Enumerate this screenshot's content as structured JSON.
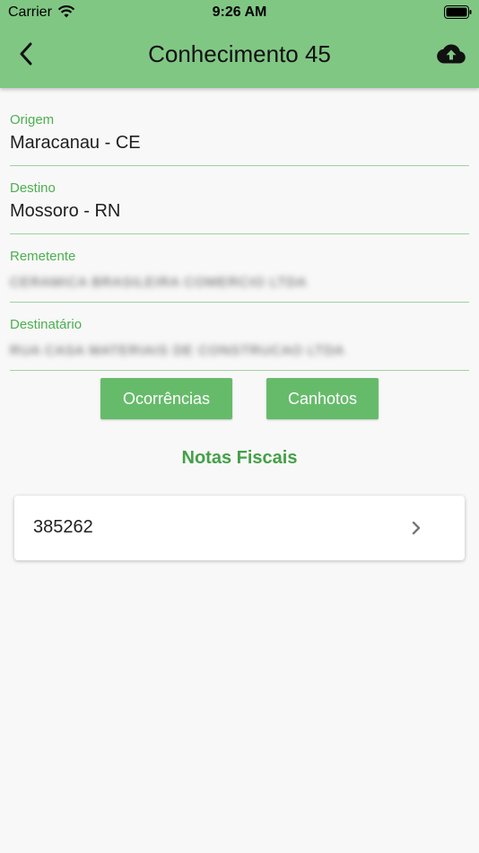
{
  "status_bar": {
    "carrier": "Carrier",
    "time": "9:26 AM"
  },
  "app_bar": {
    "title": "Conhecimento 45",
    "back_icon": "chevron-left-icon",
    "upload_icon": "cloud-upload-icon",
    "color": "#81c784"
  },
  "fields": {
    "origem": {
      "label": "Origem",
      "value": "Maracanau - CE"
    },
    "destino": {
      "label": "Destino",
      "value": "Mossoro - RN"
    },
    "remetente": {
      "label": "Remetente",
      "value": "CERAMICA BRASILEIRA COMERCIO LTDA"
    },
    "destinatario": {
      "label": "Destinatário",
      "value": "RUA CASA MATERIAIS DE CONSTRUCAO LTDA"
    }
  },
  "buttons": {
    "ocorrencias": "Ocorrências",
    "canhotos": "Canhotos"
  },
  "notas": {
    "title": "Notas Fiscais",
    "items": [
      {
        "number": "385262"
      }
    ]
  },
  "colors": {
    "accent": "#4caf50",
    "button": "#66bb6a",
    "background": "#f8f8f8"
  }
}
